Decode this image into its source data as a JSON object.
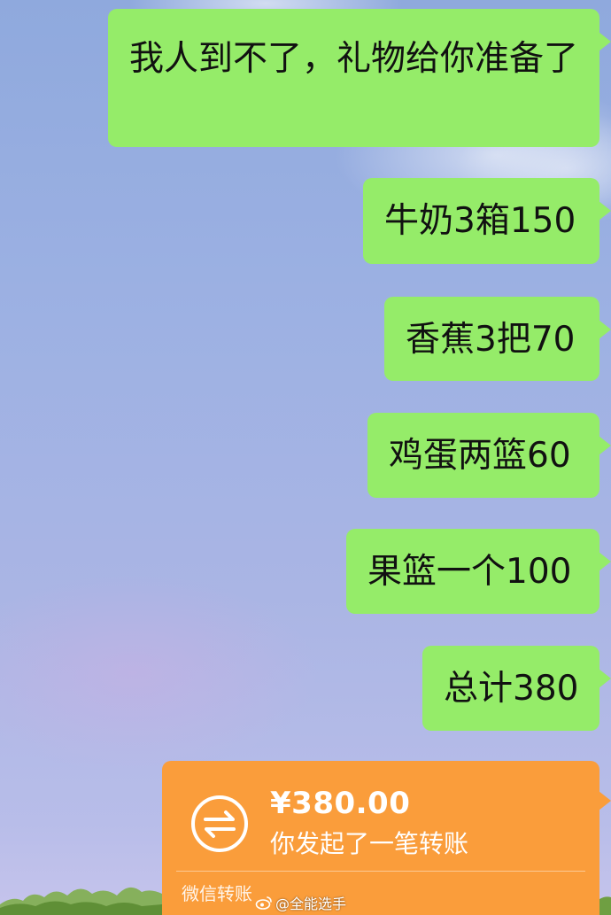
{
  "chat": {
    "messages": [
      {
        "text": "我人到不了，礼物给你准备了"
      },
      {
        "text": "牛奶3箱150"
      },
      {
        "text": "香蕉3把70"
      },
      {
        "text": "鸡蛋两篮60"
      },
      {
        "text": "果篮一个100"
      },
      {
        "text": "总计380"
      }
    ],
    "transfer": {
      "amount": "¥380.00",
      "description": "你发起了一笔转账",
      "footer": "微信转账",
      "icon": "transfer-arrows-icon"
    }
  },
  "watermark": {
    "text": "@全能选手",
    "icon": "weibo-icon"
  },
  "colors": {
    "sent_bubble": "#95ec69",
    "transfer_card": "#fa9d3b"
  }
}
